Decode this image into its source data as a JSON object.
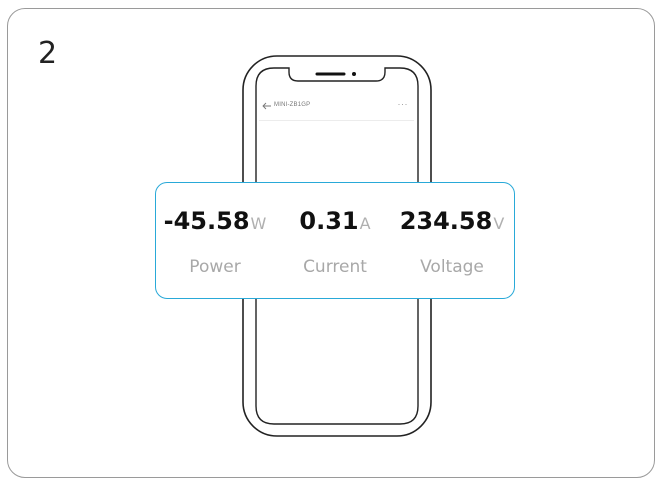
{
  "step_number": "2",
  "phone": {
    "device_name": "MINI-ZB1GP",
    "more_glyph": "···"
  },
  "metrics": [
    {
      "value": "-45.58",
      "unit": "W",
      "label": "Power"
    },
    {
      "value": "0.31",
      "unit": "A",
      "label": "Current"
    },
    {
      "value": "234.58",
      "unit": "V",
      "label": "Voltage"
    }
  ],
  "colors": {
    "panel_border": "#29a9d8",
    "card_border": "#9a9a9a"
  }
}
